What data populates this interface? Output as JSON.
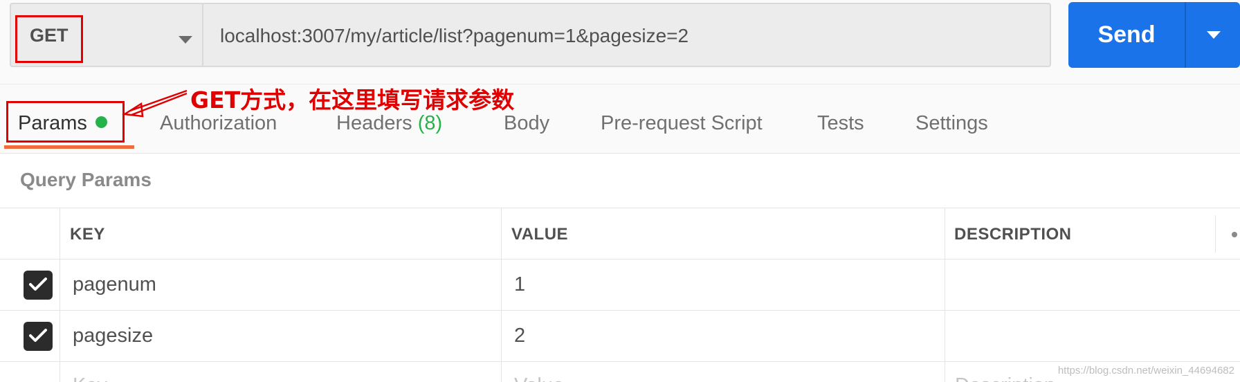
{
  "request": {
    "method": "GET",
    "url": "localhost:3007/my/article/list?pagenum=1&pagesize=2",
    "send_label": "Send"
  },
  "tabs": {
    "items": [
      {
        "label": "Params",
        "active": true
      },
      {
        "label": "Authorization"
      },
      {
        "label": "Headers",
        "count": "(8)"
      },
      {
        "label": "Body"
      },
      {
        "label": "Pre-request Script"
      },
      {
        "label": "Tests"
      },
      {
        "label": "Settings"
      }
    ]
  },
  "annotation": {
    "text": "GET方式，在这里填写请求参数",
    "color": "#e00000"
  },
  "query_params": {
    "title": "Query Params",
    "columns": {
      "key": "KEY",
      "value": "VALUE",
      "description": "DESCRIPTION"
    },
    "rows": [
      {
        "checked": true,
        "key": "pagenum",
        "value": "1",
        "description": ""
      },
      {
        "checked": true,
        "key": "pagesize",
        "value": "2",
        "description": ""
      }
    ],
    "placeholder": {
      "key": "Key",
      "value": "Value",
      "description": "Description"
    }
  },
  "watermark": "https://blog.csdn.net/weixin_44694682",
  "colors": {
    "send_button": "#1a73e8",
    "active_tab_underline": "#f26b3a",
    "status_dot": "#26b24a"
  }
}
